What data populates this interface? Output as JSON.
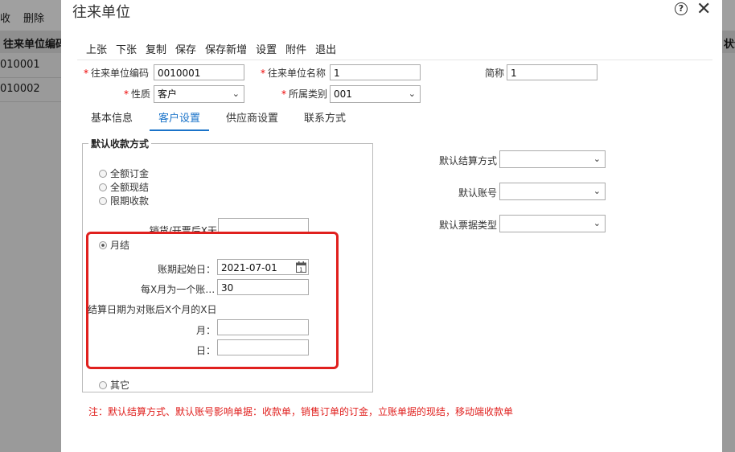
{
  "background": {
    "toolbar": [
      "收",
      "删除"
    ],
    "header": {
      "col1": "往来单位编码",
      "col_right": "状余"
    },
    "rows": [
      "010001",
      "010002"
    ]
  },
  "dialog": {
    "title": "往来单位",
    "menu": [
      "上张",
      "下张",
      "复制",
      "保存",
      "保存新增",
      "设置",
      "附件",
      "退出"
    ],
    "fields": {
      "code_label": "往来单位编码",
      "code_value": "0010001",
      "name_label": "往来单位名称",
      "name_value": "1",
      "short_label": "简称",
      "short_value": "1",
      "nature_label": "性质",
      "nature_value": "客户",
      "category_label": "所属类别",
      "category_value": "001"
    },
    "tabs": [
      "基本信息",
      "客户设置",
      "供应商设置",
      "联系方式"
    ],
    "active_tab": "客户设置",
    "receipt": {
      "legend": "默认收款方式",
      "options": [
        "全额订金",
        "全额现结",
        "限期收款"
      ],
      "hidden_label": "销货/开票后X天",
      "monthly": "月结",
      "start_date_label": "账期起始日：",
      "start_date_value": "2021-07-01",
      "period_label": "每X月为一个账…",
      "period_value": "30",
      "settle_label": "结算日期为对账后X个月的X日",
      "month_label": "月：",
      "day_label": "日：",
      "other": "其它"
    },
    "right": {
      "settle_method_label": "默认结算方式",
      "account_label": "默认账号",
      "bill_type_label": "默认票据类型"
    },
    "note": "注：默认结算方式、默认账号影响单据：收款单，销售订单的订金，立账单据的现结，移动端收款单",
    "colors": {
      "accent": "#1a73c9",
      "required": "#e00000",
      "highlight": "#e0201e"
    }
  }
}
